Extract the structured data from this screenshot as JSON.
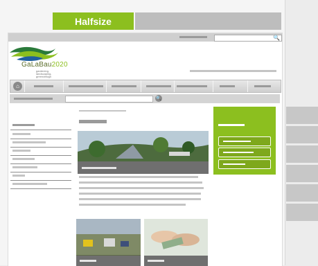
{
  "header": {
    "halfsize_label": "Halfsize"
  },
  "logo": {
    "name": "GaLaBau",
    "year": "2020",
    "tagline": "gardening, landscaping, greendesign"
  },
  "colors": {
    "accent_green": "#8cbf1f",
    "placeholder_gray": "#c4c4c4",
    "caption_gray": "#6f6f6f"
  },
  "icons": {
    "search": "search-icon",
    "home": "home-icon"
  }
}
